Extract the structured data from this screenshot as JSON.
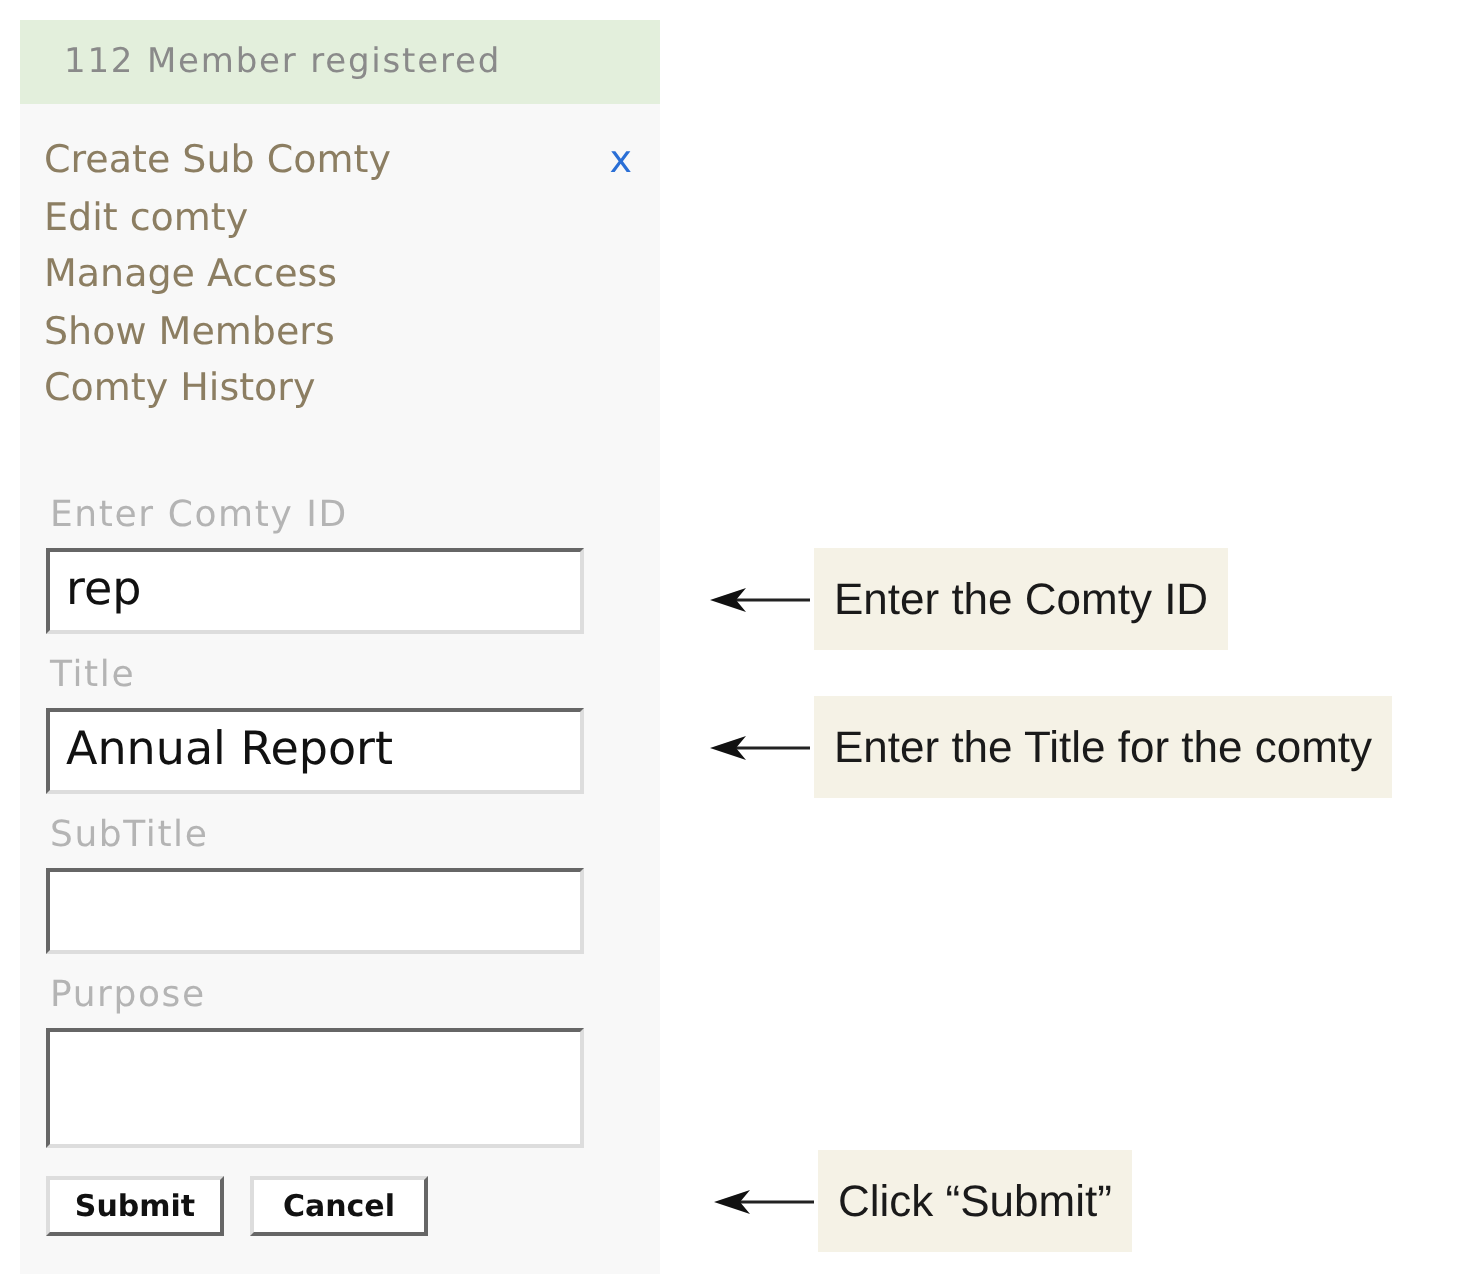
{
  "header": {
    "text": "112 Member registered"
  },
  "menu": {
    "items": [
      "Create Sub Comty",
      "Edit comty",
      "Manage Access",
      "Show Members",
      "Comty History"
    ],
    "close": "x"
  },
  "fields": [
    {
      "label": "Enter Comty ID",
      "value": "rep",
      "kind": "input"
    },
    {
      "label": "Title",
      "value": "Annual Report",
      "kind": "input"
    },
    {
      "label": "SubTitle",
      "kind": "input"
    },
    {
      "label": "Purpose",
      "kind": "textarea"
    }
  ],
  "buttons": [
    "Submit",
    "Cancel"
  ],
  "callouts": [
    {
      "text": "Enter the Comty ID"
    },
    {
      "text": "Enter the Title for the comty"
    },
    {
      "text": "Click “Submit”"
    }
  ]
}
